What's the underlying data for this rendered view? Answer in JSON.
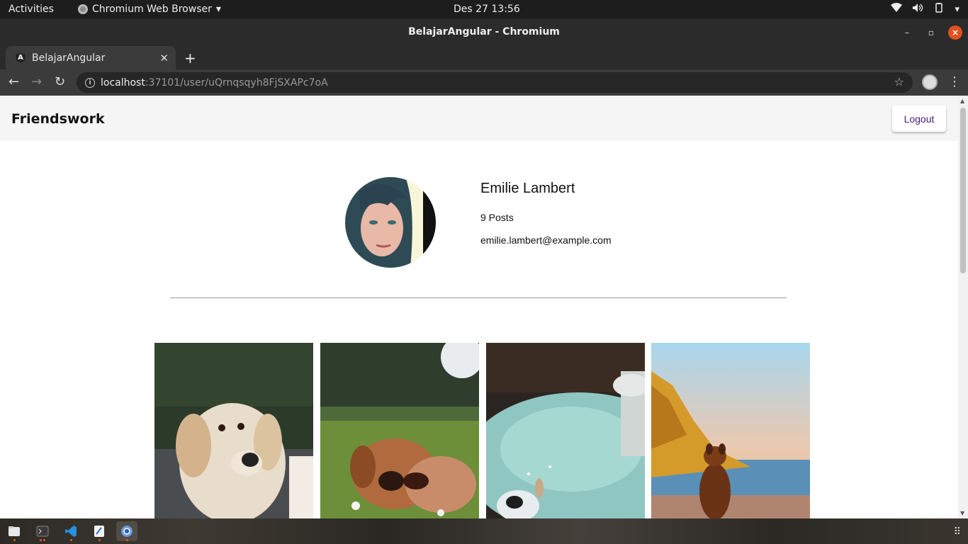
{
  "system": {
    "activities": "Activities",
    "app_menu": "Chromium Web Browser",
    "clock": "Des 27  13:56"
  },
  "window": {
    "title": "BelajarAngular - Chromium"
  },
  "tab": {
    "title": "BelajarAngular",
    "favicon_letter": "A"
  },
  "address": {
    "host": "localhost",
    "path": ":37101/user/uQrnqsqyh8FjSXAPc7oA"
  },
  "app": {
    "brand": "Friendswork",
    "logout_label": "Logout"
  },
  "profile": {
    "name": "Emilie Lambert",
    "posts": "9 Posts",
    "email": "emilie.lambert@example.com"
  },
  "photos": [
    "dog-golden-retriever",
    "dog-pekingese-grass",
    "dog-splashing-water",
    "dog-beach-sunset"
  ],
  "colors": {
    "logout_text": "#4a1a7a",
    "close_button": "#e0501d"
  }
}
